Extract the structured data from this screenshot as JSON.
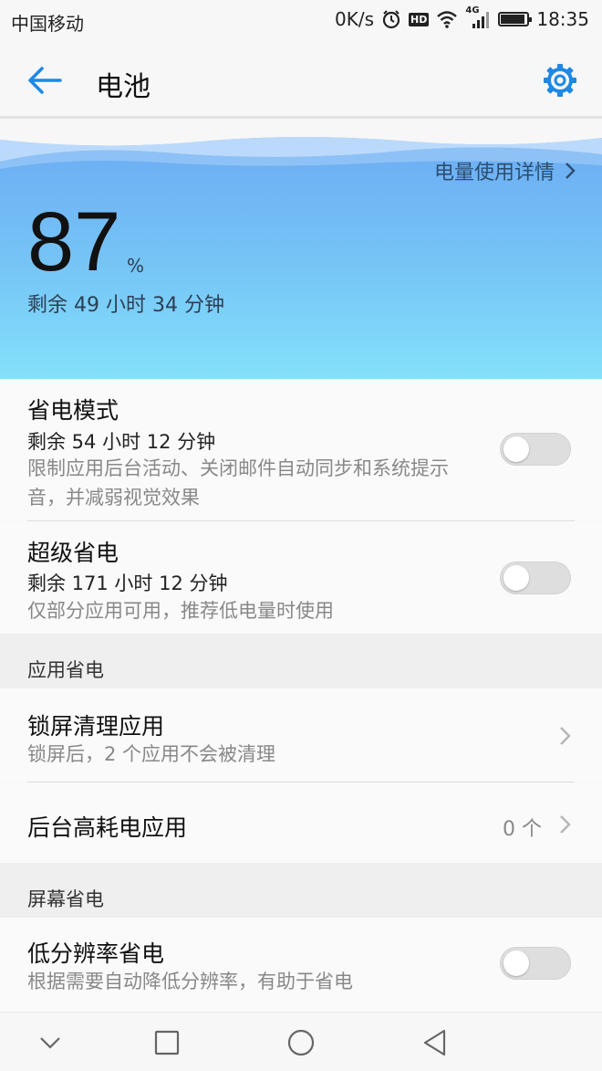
{
  "status_bar": {
    "carrier": "中国移动",
    "speed": "0K/s",
    "hd": "HD",
    "network": "4G",
    "time": "18:35"
  },
  "app_bar": {
    "title": "电池"
  },
  "battery": {
    "detail_link": "电量使用详情",
    "percent": "87",
    "percent_unit": "%",
    "remaining": "剩余 49 小时 34 分钟",
    "colors": {
      "gradient_top": "#6aa9f3",
      "gradient_bottom": "#83e1fb"
    }
  },
  "power_saving": {
    "title": "省电模式",
    "remaining": "剩余 54 小时 12 分钟",
    "description": "限制应用后台活动、关闭邮件自动同步和系统提示音，并减弱视觉效果",
    "enabled": false
  },
  "ultra_saving": {
    "title": "超级省电",
    "remaining": "剩余 171 小时 12 分钟",
    "description": "仅部分应用可用，推荐低电量时使用",
    "enabled": false
  },
  "app_saving": {
    "header": "应用省电",
    "lockscreen_cleanup": {
      "title": "锁屏清理应用",
      "description": "锁屏后，2 个应用不会被清理"
    },
    "background_heavy": {
      "title": "后台高耗电应用",
      "value": "0 个"
    }
  },
  "screen_saving": {
    "header": "屏幕省电",
    "low_resolution": {
      "title": "低分辨率省电",
      "description": "根据需要自动降低分辨率，有助于省电",
      "enabled": false
    }
  },
  "accent_color": "#1e88e5"
}
